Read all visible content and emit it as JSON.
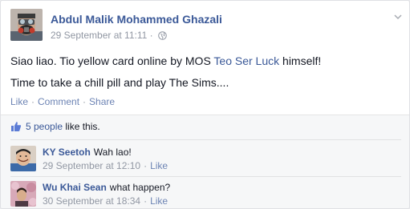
{
  "post": {
    "author": "Abdul Malik Mohammed Ghazali",
    "timestamp": "29 September at 11:11",
    "meta_separator": "·",
    "line1_prefix": "Siao liao. Tio yellow card online by MOS ",
    "line1_mention": "Teo Ser Luck",
    "line1_suffix": " himself!",
    "line2": "Time to take a chill pill and play The Sims....",
    "actions": {
      "like": "Like",
      "comment": "Comment",
      "share": "Share",
      "separator": "·"
    }
  },
  "likes": {
    "count_text": "5 people",
    "suffix": " like this."
  },
  "comments": [
    {
      "author": "KY Seetoh",
      "text": "Wah lao!",
      "timestamp": "29 September at 12:10",
      "like": "Like"
    },
    {
      "author": "Wu Khai Sean",
      "text": "what happen?",
      "timestamp": "30 September at 18:34",
      "like": "Like"
    }
  ],
  "colors": {
    "link": "#3b5998",
    "action": "#6d84b4",
    "muted": "#9197a3",
    "text": "#141823"
  }
}
